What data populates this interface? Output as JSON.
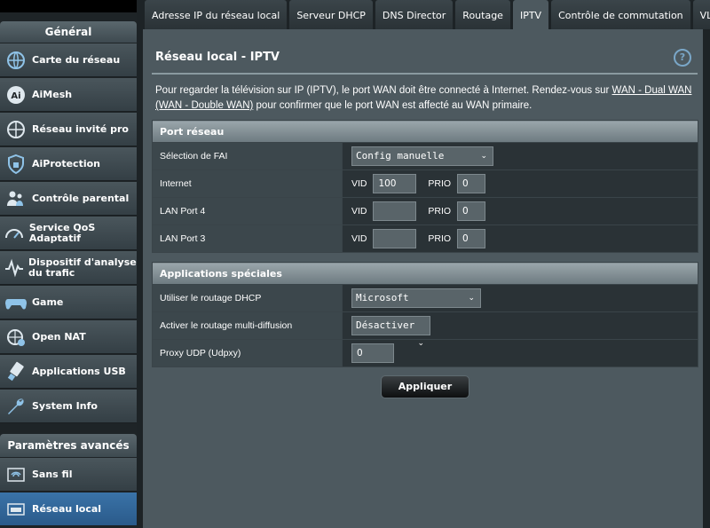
{
  "sidebar": {
    "general_title": "Général",
    "items": [
      {
        "label": "Carte du réseau",
        "icon": "network-map-icon"
      },
      {
        "label": "AiMesh",
        "icon": "aimesh-icon"
      },
      {
        "label": "Réseau invité pro",
        "icon": "guest-network-icon"
      },
      {
        "label": "AiProtection",
        "icon": "shield-icon"
      },
      {
        "label": "Contrôle parental",
        "icon": "parental-control-icon"
      },
      {
        "label": "Service QoS Adaptatif",
        "icon": "qos-gauge-icon"
      },
      {
        "label": "Dispositif d'analyse du trafic",
        "icon": "traffic-analyzer-icon"
      },
      {
        "label": "Game",
        "icon": "gamepad-icon"
      },
      {
        "label": "Open NAT",
        "icon": "open-nat-icon"
      },
      {
        "label": "Applications USB",
        "icon": "usb-icon"
      },
      {
        "label": "System Info",
        "icon": "wrench-icon"
      }
    ],
    "advanced_title": "Paramètres avancés",
    "advanced_items": [
      {
        "label": "Sans fil",
        "icon": "wifi-icon"
      },
      {
        "label": "Réseau local",
        "icon": "lan-icon",
        "active": true
      }
    ]
  },
  "tabs": [
    {
      "label": "Adresse IP du réseau local"
    },
    {
      "label": "Serveur DHCP"
    },
    {
      "label": "DNS Director"
    },
    {
      "label": "Routage"
    },
    {
      "label": "IPTV",
      "active": true
    },
    {
      "label": "Contrôle de commutation"
    },
    {
      "label": "VLAN"
    }
  ],
  "page": {
    "title": "Réseau local - IPTV",
    "help": "?",
    "description_prefix": "Pour regarder la télévision sur IP (IPTV), le port WAN doit être connecté à Internet. Rendez-vous sur ",
    "description_link": "WAN - Dual WAN (WAN - Double WAN)",
    "description_suffix": " pour confirmer que le port WAN est affecté au WAN primaire."
  },
  "port_section": {
    "header": "Port réseau",
    "isp_label": "Sélection de FAI",
    "isp_value": "Config manuelle",
    "vid_label": "VID",
    "prio_label": "PRIO",
    "rows": [
      {
        "label": "Internet",
        "vid": "100",
        "prio": "0"
      },
      {
        "label": "LAN Port 4",
        "vid": "",
        "prio": "0"
      },
      {
        "label": "LAN Port 3",
        "vid": "",
        "prio": "0"
      }
    ]
  },
  "special_section": {
    "header": "Applications spéciales",
    "dhcp_label": "Utiliser le routage DHCP",
    "dhcp_value": "Microsoft",
    "multicast_label": "Activer le routage multi-diffusion",
    "multicast_value": "Désactiver",
    "udpxy_label": "Proxy UDP (Udpxy)",
    "udpxy_value": "0"
  },
  "apply_label": "Appliquer",
  "colors": {
    "accent_blue": "#2a5a8a",
    "panel": "#4d595f",
    "help": "#7aa7c8"
  }
}
